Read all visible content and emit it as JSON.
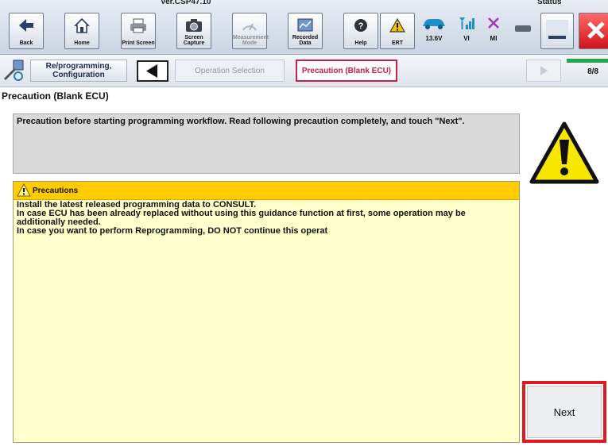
{
  "toolbar": {
    "version": "Ver.CSP47.10",
    "status_label": "Status",
    "buttons": [
      {
        "label": "Back",
        "icon": "back-arrow-icon"
      },
      {
        "label": "Home",
        "icon": "home-icon"
      },
      {
        "label": "Print Screen",
        "icon": "printer-icon"
      },
      {
        "label": "Screen Capture",
        "icon": "camera-icon"
      },
      {
        "label": "Measurement Mode",
        "icon": "measurement-icon"
      },
      {
        "label": "Recorded Data",
        "icon": "recorded-data-icon"
      },
      {
        "label": "Help",
        "icon": "help-icon"
      },
      {
        "label": "ERT",
        "icon": "warning-icon"
      }
    ],
    "status": {
      "voltage": "13.6V",
      "vi": "VI",
      "mi": "MI"
    }
  },
  "breadcrumb": {
    "step1": "Re/programming, Configuration",
    "step2": "Operation Selection",
    "step3": "Precaution (Blank ECU)",
    "progress": "8/8"
  },
  "page": {
    "title": "Precaution (Blank ECU)",
    "message": "Precaution before starting programming workflow. Read following precaution completely, and touch \"Next\".",
    "precautions": {
      "header": "Precautions",
      "lines": [
        "Install the latest released programming data to CONSULT.",
        "In case ECU has been already replaced without using this guidance function at first, some operation may be additionally needed.",
        "In case you want to perform Reprogramming, DO NOT continue this operat"
      ]
    },
    "next_label": "Next"
  },
  "colors": {
    "accent_red": "#e0191f",
    "precaution_header": "#ffcc00",
    "precaution_body": "#ffffcc"
  }
}
